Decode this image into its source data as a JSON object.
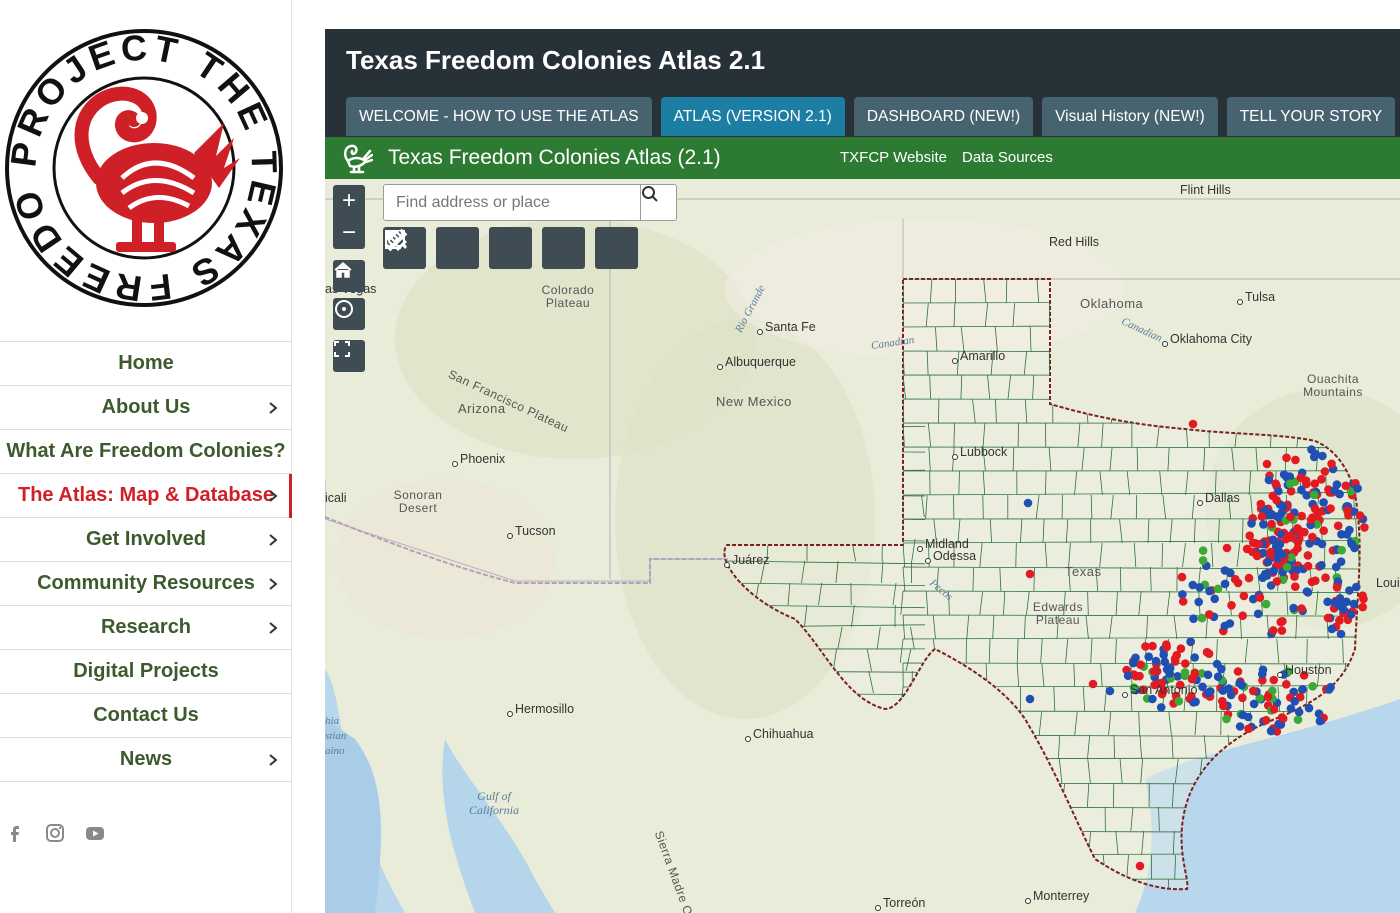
{
  "logo": {
    "ring_text": "PROJECT THE TEXAS FREEDOM COLONIES",
    "colors": {
      "ring": "#111111",
      "bird": "#cf2027"
    }
  },
  "nav": {
    "items": [
      {
        "label": "Home",
        "has_submenu": false,
        "active": false
      },
      {
        "label": "About Us",
        "has_submenu": true,
        "active": false
      },
      {
        "label": "What Are Freedom Colonies?",
        "has_submenu": false,
        "active": false
      },
      {
        "label": "The Atlas: Map & Database",
        "has_submenu": true,
        "active": true
      },
      {
        "label": "Get Involved",
        "has_submenu": true,
        "active": false
      },
      {
        "label": "Community Resources",
        "has_submenu": true,
        "active": false
      },
      {
        "label": "Research",
        "has_submenu": true,
        "active": false
      },
      {
        "label": "Digital Projects",
        "has_submenu": false,
        "active": false
      },
      {
        "label": "Contact Us",
        "has_submenu": false,
        "active": false
      },
      {
        "label": "News",
        "has_submenu": true,
        "active": false
      }
    ],
    "colors": {
      "text": "#3d5a2e",
      "active": "#cf2027"
    }
  },
  "social": [
    "facebook-icon",
    "instagram-icon",
    "youtube-icon"
  ],
  "app": {
    "title": "Texas Freedom Colonies Atlas 2.1",
    "tabs": [
      {
        "label": "WELCOME - HOW TO USE THE ATLAS",
        "active": false
      },
      {
        "label": "ATLAS (VERSION 2.1)",
        "active": true
      },
      {
        "label": "DASHBOARD (NEW!)",
        "active": false
      },
      {
        "label": "Visual History (NEW!)",
        "active": false
      },
      {
        "label": "TELL YOUR STORY",
        "active": false
      }
    ],
    "header": {
      "title": "Texas Freedom Colonies Atlas (2.1)",
      "links": [
        "TXFCP Website",
        "Data Sources"
      ]
    },
    "colors": {
      "panel": "#263238",
      "tab": "#47636f",
      "tab_active": "#1d7ea3",
      "header": "#2d7a33"
    }
  },
  "map": {
    "search_placeholder": "Find address or place",
    "tools": [
      "search-map-icon",
      "layer-list-icon",
      "draw-icon",
      "filter-icon",
      "measure-icon"
    ],
    "controls": [
      "zoom-in",
      "zoom-out",
      "home",
      "locate",
      "fullscreen"
    ],
    "labels": {
      "cities": [
        "Santa Fe",
        "Albuquerque",
        "Amarillo",
        "Lubbock",
        "Midland",
        "Odessa",
        "Dallas",
        "Houston",
        "San Antonio",
        "Tulsa",
        "Oklahoma City",
        "Phoenix",
        "Tucson",
        "Juárez",
        "Hermosillo",
        "Chihuahua",
        "Torreón",
        "Monterrey"
      ],
      "regions": [
        "Oklahoma",
        "New Mexico",
        "Arizona",
        "Texas",
        "Colorado Plateau",
        "San Francisco Plateau",
        "Sonoran Desert",
        "Edwards Plateau",
        "Ouachita Mountains",
        "Flint Hills",
        "Red Hills",
        "Gulf of California",
        "Sierra Madre Occid"
      ],
      "rivers": [
        "Rio Grande",
        "Canadian",
        "Pecos"
      ],
      "cutoff": [
        "as Vegas",
        "icali",
        "hia",
        "stian",
        "aino",
        "Loui"
      ]
    },
    "dot_colors": {
      "red": "#e21b23",
      "blue": "#1f4fb3",
      "green": "#3aa935"
    }
  }
}
